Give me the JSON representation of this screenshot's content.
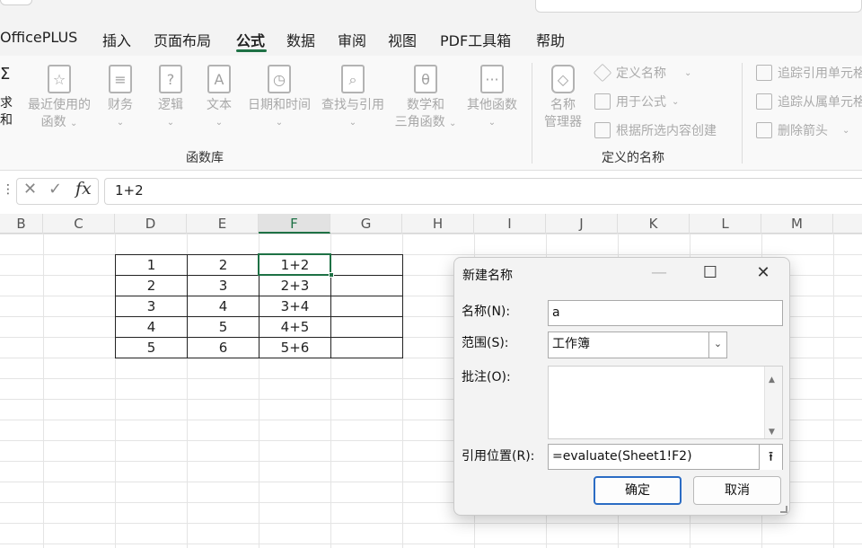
{
  "ribbon_tabs": [
    "OfficePLUS",
    "插入",
    "页面布局",
    "公式",
    "数据",
    "审阅",
    "视图",
    "PDF工具箱",
    "帮助"
  ],
  "active_tab": "公式",
  "function_library": {
    "cut_label": "求和",
    "buttons": [
      {
        "line1": "最近使用的",
        "line2": "函数"
      },
      {
        "line1": "财务",
        "line2": ""
      },
      {
        "line1": "逻辑",
        "line2": ""
      },
      {
        "line1": "文本",
        "line2": ""
      },
      {
        "line1": "日期和时间",
        "line2": ""
      },
      {
        "line1": "查找与引用",
        "line2": ""
      },
      {
        "line1": "数学和",
        "line2": "三角函数"
      },
      {
        "line1": "其他函数",
        "line2": ""
      }
    ],
    "group_label": "函数库"
  },
  "defined_names": {
    "name_manager_line1": "名称",
    "name_manager_line2": "管理器",
    "define_name": "定义名称",
    "use_in_formula": "用于公式",
    "create_from_selection": "根据所选内容创建",
    "group_label": "定义的名称"
  },
  "formula_auditing": {
    "trace_precedents": "追踪引用单元格",
    "trace_dependents": "追踪从属单元格",
    "remove_arrows": "删除箭头"
  },
  "formula_bar": {
    "content": "1+2"
  },
  "column_headers": [
    "B",
    "C",
    "D",
    "E",
    "F",
    "G",
    "H",
    "I",
    "J",
    "K",
    "L",
    "M"
  ],
  "selected_column": "F",
  "table": [
    [
      "1",
      "2",
      "1+2",
      ""
    ],
    [
      "2",
      "3",
      "2+3",
      ""
    ],
    [
      "3",
      "4",
      "3+4",
      ""
    ],
    [
      "4",
      "5",
      "4+5",
      ""
    ],
    [
      "5",
      "6",
      "5+6",
      ""
    ]
  ],
  "dialog": {
    "title": "新建名称",
    "name_label": "名称(N):",
    "name_value": "a",
    "scope_label": "范围(S):",
    "scope_value": "工作簿",
    "comment_label": "批注(O):",
    "comment_value": "",
    "refers_label": "引用位置(R):",
    "refers_value": "=evaluate(Sheet1!F2)",
    "ok": "确定",
    "cancel": "取消"
  }
}
